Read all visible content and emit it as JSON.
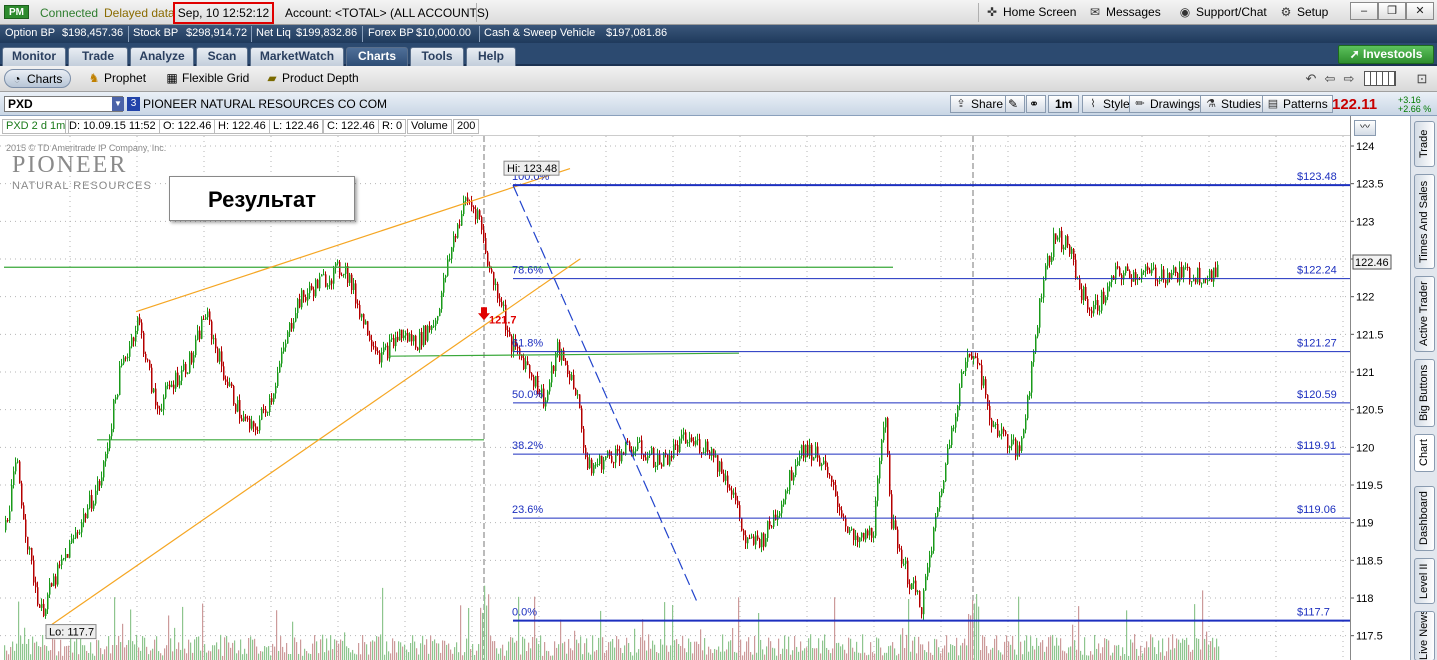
{
  "status": {
    "pm_badge": "PM",
    "connected": "Connected",
    "delayed": "Delayed data",
    "datetime": "Sep, 10  12:52:12",
    "account": "Account: <TOTAL> (ALL ACCOUNTS)",
    "home": "Home Screen",
    "messages": "Messages",
    "support": "Support/Chat",
    "setup": "Setup"
  },
  "balances": [
    {
      "label": "Option BP",
      "value": "$198,457.36"
    },
    {
      "label": "Stock BP",
      "value": "$298,914.72"
    },
    {
      "label": "Net Liq",
      "value": "$199,832.86"
    },
    {
      "label": "Forex BP",
      "value": "$10,000.00"
    },
    {
      "label": "Cash & Sweep Vehicle",
      "value": "$197,081.86"
    }
  ],
  "main_tabs": [
    "Monitor",
    "Trade",
    "Analyze",
    "Scan",
    "MarketWatch",
    "Charts",
    "Tools",
    "Help"
  ],
  "active_tab": "Charts",
  "investools": "Investools",
  "sub_tabs": [
    "Charts",
    "Prophet",
    "Flexible Grid",
    "Product Depth"
  ],
  "symbol": {
    "ticker": "PXD",
    "link": "3",
    "name": "PIONEER NATURAL RESOURCES CO COM",
    "price": "122.11",
    "change": "+3.16",
    "change_pct": "+2.66 %"
  },
  "chart_buttons": {
    "share": "Share",
    "interval": "1m",
    "style": "Style",
    "drawings": "Drawings",
    "studies": "Studies",
    "patterns": "Patterns"
  },
  "info": {
    "desc": "PXD 2 d 1m",
    "date": "D: 10.09.15 11:52",
    "open": "O: 122.46",
    "high": "H: 122.46",
    "low": "L: 122.46",
    "close": "C: 122.46",
    "r": "R: 0",
    "volume_label": "Volume",
    "volume": "200"
  },
  "side_tabs": [
    "Trade",
    "Times And Sales",
    "Active Trader",
    "Big Buttons",
    "Chart",
    "Dashboard",
    "Level II",
    "Live News"
  ],
  "overlay": {
    "result": "Результат",
    "watermark": "2015 © TD Ameritrade IP Company, Inc.",
    "logo_main": "PIONEER",
    "logo_sub": "NATURAL RESOURCES",
    "hi_label": "Hi: 123.48",
    "lo_label": "Lo: 117.7",
    "arrow_label": "121.7",
    "last_price": "122.46"
  },
  "colors": {
    "up": "#1a9a1a",
    "down": "#b40000",
    "fib": "#1c2fbf",
    "trend": "#f5a623",
    "support": "#3aa83a",
    "accent": "#c80000"
  },
  "chart_data": {
    "type": "candlestick",
    "yticks": [
      117.5,
      118,
      118.5,
      119,
      119.5,
      120,
      120.5,
      121,
      121.5,
      122,
      122.5,
      123,
      123.5,
      124
    ],
    "ylim": [
      117.4,
      124.2
    ],
    "high": 123.48,
    "low": 117.7,
    "last": 122.46,
    "fib_levels": [
      {
        "pct": "100.0%",
        "price": "$123.48",
        "value": 123.48
      },
      {
        "pct": "78.6%",
        "price": "$122.24",
        "value": 122.24
      },
      {
        "pct": "61.8%",
        "price": "$121.27",
        "value": 121.27
      },
      {
        "pct": "50.0%",
        "price": "$120.59",
        "value": 120.59
      },
      {
        "pct": "38.2%",
        "price": "$119.91",
        "value": 119.91
      },
      {
        "pct": "23.6%",
        "price": "$119.06",
        "value": 119.06
      },
      {
        "pct": "0.0%",
        "price": "$117.7",
        "value": 117.7
      }
    ],
    "price_path": [
      [
        0,
        118.9
      ],
      [
        0.01,
        119.8
      ],
      [
        0.02,
        118.6
      ],
      [
        0.03,
        117.8
      ],
      [
        0.04,
        118.2
      ],
      [
        0.06,
        118.9
      ],
      [
        0.08,
        119.6
      ],
      [
        0.095,
        121.0
      ],
      [
        0.11,
        121.7
      ],
      [
        0.125,
        120.5
      ],
      [
        0.14,
        120.9
      ],
      [
        0.155,
        121.2
      ],
      [
        0.165,
        121.8
      ],
      [
        0.18,
        121.0
      ],
      [
        0.195,
        120.4
      ],
      [
        0.205,
        120.2
      ],
      [
        0.22,
        120.7
      ],
      [
        0.24,
        121.9
      ],
      [
        0.26,
        122.2
      ],
      [
        0.28,
        122.4
      ],
      [
        0.295,
        121.7
      ],
      [
        0.31,
        121.2
      ],
      [
        0.325,
        121.5
      ],
      [
        0.34,
        121.4
      ],
      [
        0.355,
        121.7
      ],
      [
        0.37,
        122.8
      ],
      [
        0.38,
        123.3
      ],
      [
        0.39,
        123.1
      ],
      [
        0.4,
        122.3
      ],
      [
        0.41,
        121.9
      ],
      [
        0.415,
        121.4
      ],
      [
        0.43,
        121.1
      ],
      [
        0.445,
        120.6
      ],
      [
        0.455,
        121.3
      ],
      [
        0.47,
        120.8
      ],
      [
        0.48,
        119.7
      ],
      [
        0.5,
        119.9
      ],
      [
        0.52,
        120.0
      ],
      [
        0.54,
        119.8
      ],
      [
        0.56,
        120.1
      ],
      [
        0.58,
        120.0
      ],
      [
        0.6,
        119.4
      ],
      [
        0.61,
        118.7
      ],
      [
        0.625,
        118.8
      ],
      [
        0.64,
        119.3
      ],
      [
        0.655,
        120.0
      ],
      [
        0.67,
        119.9
      ],
      [
        0.68,
        119.5
      ],
      [
        0.69,
        119.1
      ],
      [
        0.7,
        118.7
      ],
      [
        0.715,
        118.9
      ],
      [
        0.725,
        120.5
      ],
      [
        0.73,
        119.0
      ],
      [
        0.745,
        118.2
      ],
      [
        0.755,
        117.9
      ],
      [
        0.765,
        118.9
      ],
      [
        0.78,
        120.3
      ],
      [
        0.79,
        121.1
      ],
      [
        0.8,
        121.3
      ],
      [
        0.81,
        120.4
      ],
      [
        0.82,
        120.2
      ],
      [
        0.835,
        119.9
      ],
      [
        0.845,
        121.0
      ],
      [
        0.855,
        122.3
      ],
      [
        0.865,
        122.8
      ],
      [
        0.875,
        122.7
      ],
      [
        0.885,
        122.1
      ],
      [
        0.895,
        121.8
      ],
      [
        0.905,
        122.0
      ],
      [
        0.915,
        122.3
      ]
    ]
  }
}
